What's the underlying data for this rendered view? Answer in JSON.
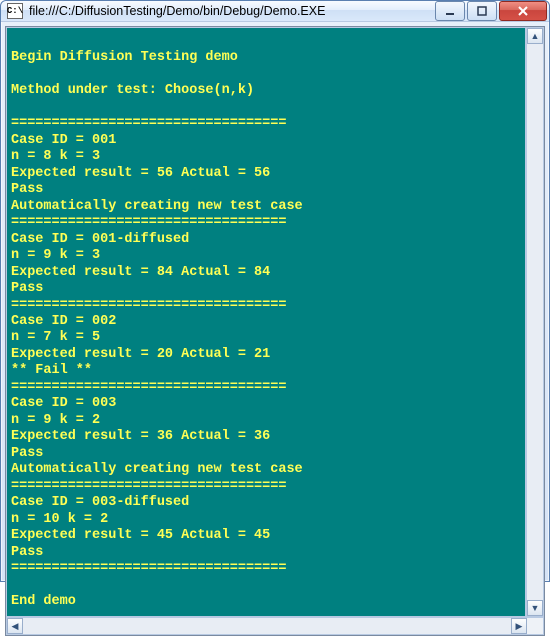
{
  "window": {
    "title": "file:///C:/DiffusionTesting/Demo/bin/Debug/Demo.EXE",
    "icon_label": "C:\\"
  },
  "buttons": {
    "minimize": "–",
    "maximize": "□",
    "close": "X"
  },
  "scroll": {
    "up": "▲",
    "down": "▼",
    "left": "◀",
    "right": "▶"
  },
  "console_output": "\nBegin Diffusion Testing demo\n\nMethod under test: Choose(n,k)\n\n==================================\nCase ID = 001\nn = 8 k = 3\nExpected result = 56 Actual = 56\nPass\nAutomatically creating new test case\n==================================\nCase ID = 001-diffused\nn = 9 k = 3\nExpected result = 84 Actual = 84\nPass\n==================================\nCase ID = 002\nn = 7 k = 5\nExpected result = 20 Actual = 21\n** Fail **\n==================================\nCase ID = 003\nn = 9 k = 2\nExpected result = 36 Actual = 36\nPass\nAutomatically creating new test case\n==================================\nCase ID = 003-diffused\nn = 10 k = 2\nExpected result = 45 Actual = 45\nPass\n==================================\n\nEnd demo"
}
